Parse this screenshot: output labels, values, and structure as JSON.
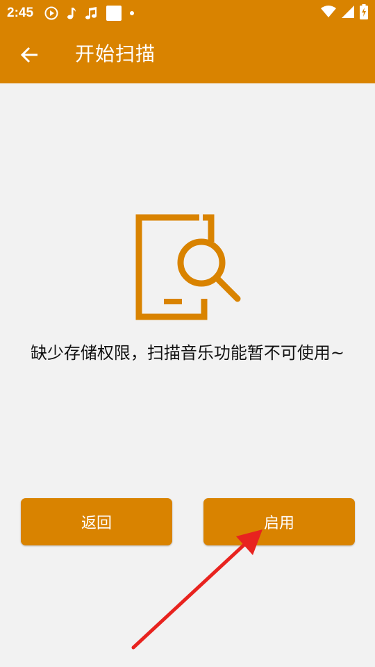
{
  "status_bar": {
    "time": "2:45",
    "icons": [
      "play-circle-icon",
      "music-note-icon",
      "music-notes-icon",
      "square-notification-icon",
      "dot-icon"
    ],
    "right_icons": [
      "wifi-icon",
      "signal-icon",
      "battery-charging-icon"
    ]
  },
  "app_bar": {
    "back_icon": "arrow-left-icon",
    "title": "开始扫描"
  },
  "content": {
    "illustration_icon": "document-search-icon",
    "message": "缺少存储权限，扫描音乐功能暂不可使用~"
  },
  "buttons": {
    "back_label": "返回",
    "enable_label": "启用"
  },
  "colors": {
    "accent": "#d98300",
    "background": "#f2f2f2",
    "annotation_arrow": "#e8231f"
  }
}
